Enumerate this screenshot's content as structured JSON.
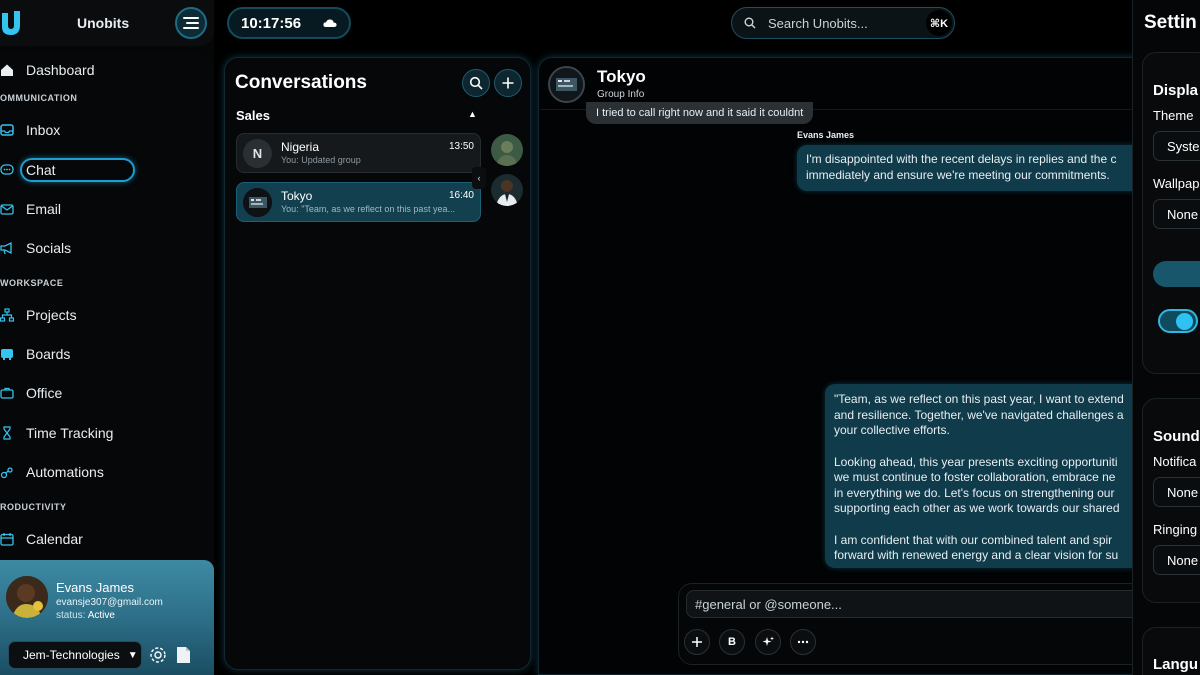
{
  "brand": {
    "name": "Unobits"
  },
  "topbar": {
    "clock": "10:17:56",
    "search_placeholder": "Search Unobits...",
    "search_shortcut": "⌘K"
  },
  "nav": {
    "dashboard": "Dashboard",
    "section_communication": "OMMUNICATION",
    "inbox": "Inbox",
    "chat": "Chat",
    "email": "Email",
    "socials": "Socials",
    "section_workspace": "WORKSPACE",
    "projects": "Projects",
    "boards": "Boards",
    "office": "Office",
    "time_tracking": "Time Tracking",
    "automations": "Automations",
    "section_productivity": "RODUCTIVITY",
    "calendar": "Calendar"
  },
  "user": {
    "name": "Evans James",
    "email": "evansje307@gmail.com",
    "status_label": "status:",
    "status_value": "Active",
    "org": "Jem-Technologies"
  },
  "conversations": {
    "title": "Conversations",
    "group_label": "Sales",
    "items": [
      {
        "initial": "N",
        "name": "Nigeria",
        "time": "13:50",
        "preview": "You: Updated group"
      },
      {
        "name": "Tokyo",
        "time": "16:40",
        "preview": "You: \"Team, as we reflect on this past yea..."
      }
    ]
  },
  "chat": {
    "title": "Tokyo",
    "subtitle": "Group Info",
    "faded_top": "I tried to call right now and it said it couldnt",
    "sender": "Evans James",
    "message_1": [
      "I'm disappointed with the recent delays in replies and the c",
      "immediately and ensure we're meeting our commitments."
    ],
    "message_2": [
      "\"Team, as we reflect on this past year, I want to extend",
      "and resilience. Together, we've navigated challenges a",
      "your collective efforts.",
      "",
      "Looking ahead, this year presents exciting opportuniti",
      "we must continue to foster collaboration, embrace ne",
      "in everything we do. Let's focus on strengthening our",
      "supporting each other as we work towards our shared",
      "",
      "I am confident that with our combined talent and spir",
      "forward with renewed energy and a clear vision for su"
    ],
    "composer_placeholder": "#general or @someone...",
    "bold_label": "B"
  },
  "settings": {
    "title": "Settin",
    "display_head": "Displa",
    "theme_label": "Theme",
    "theme_value": "Syste",
    "wallpaper_label": "Wallpap",
    "wallpaper_value": "None",
    "sound_head": "Sound",
    "notification_label": "Notifica",
    "notification_value": "None",
    "ringing_label": "Ringing",
    "ringing_value": "None",
    "language_head": "Langu"
  },
  "colors": {
    "accent": "#1b9ed0",
    "bubble": "#0f3b4a",
    "active_conv": "#12404f"
  }
}
